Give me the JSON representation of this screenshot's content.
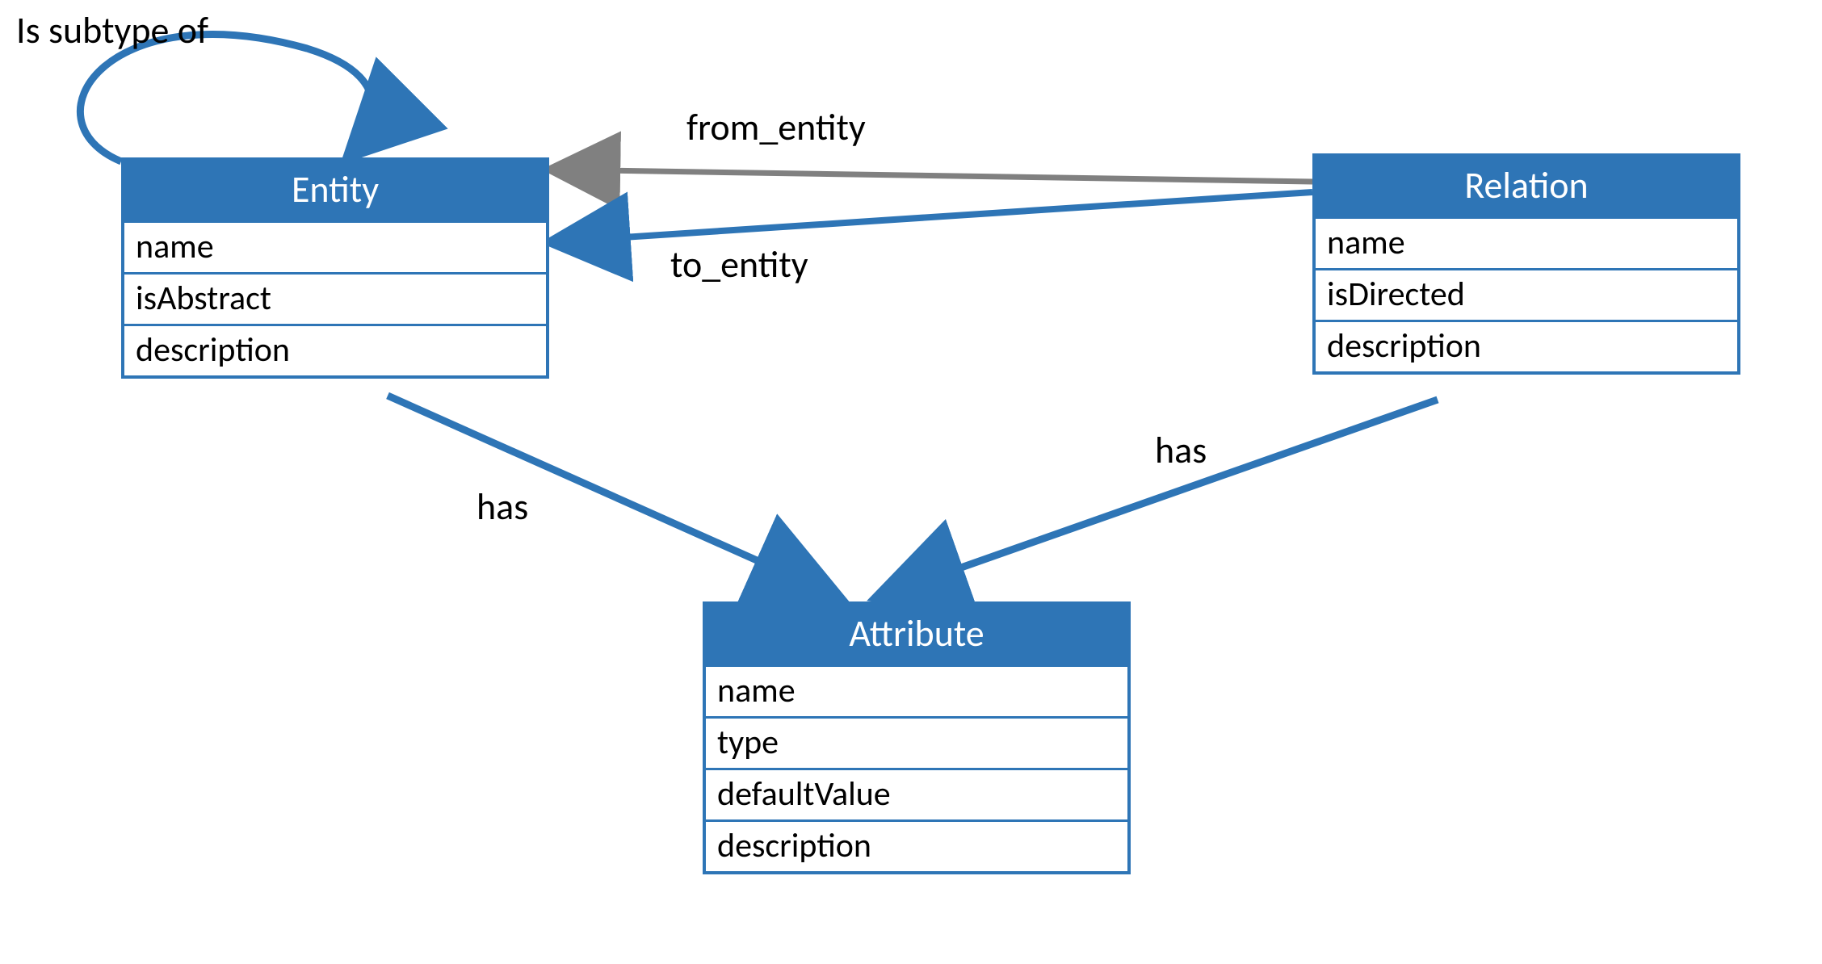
{
  "colors": {
    "primary": "#2E75B6",
    "text": "#000000",
    "bg": "#ffffff"
  },
  "boxes": {
    "entity": {
      "title": "Entity",
      "attrs": [
        "name",
        "isAbstract",
        "description"
      ]
    },
    "relation": {
      "title": "Relation",
      "attrs": [
        "name",
        "isDirected",
        "description"
      ]
    },
    "attribute": {
      "title": "Attribute",
      "attrs": [
        "name",
        "type",
        "defaultValue",
        "description"
      ]
    }
  },
  "edges": {
    "subtype": "Is subtype of",
    "from_entity": "from_entity",
    "to_entity": "to_entity",
    "has_left": "has",
    "has_right": "has"
  }
}
